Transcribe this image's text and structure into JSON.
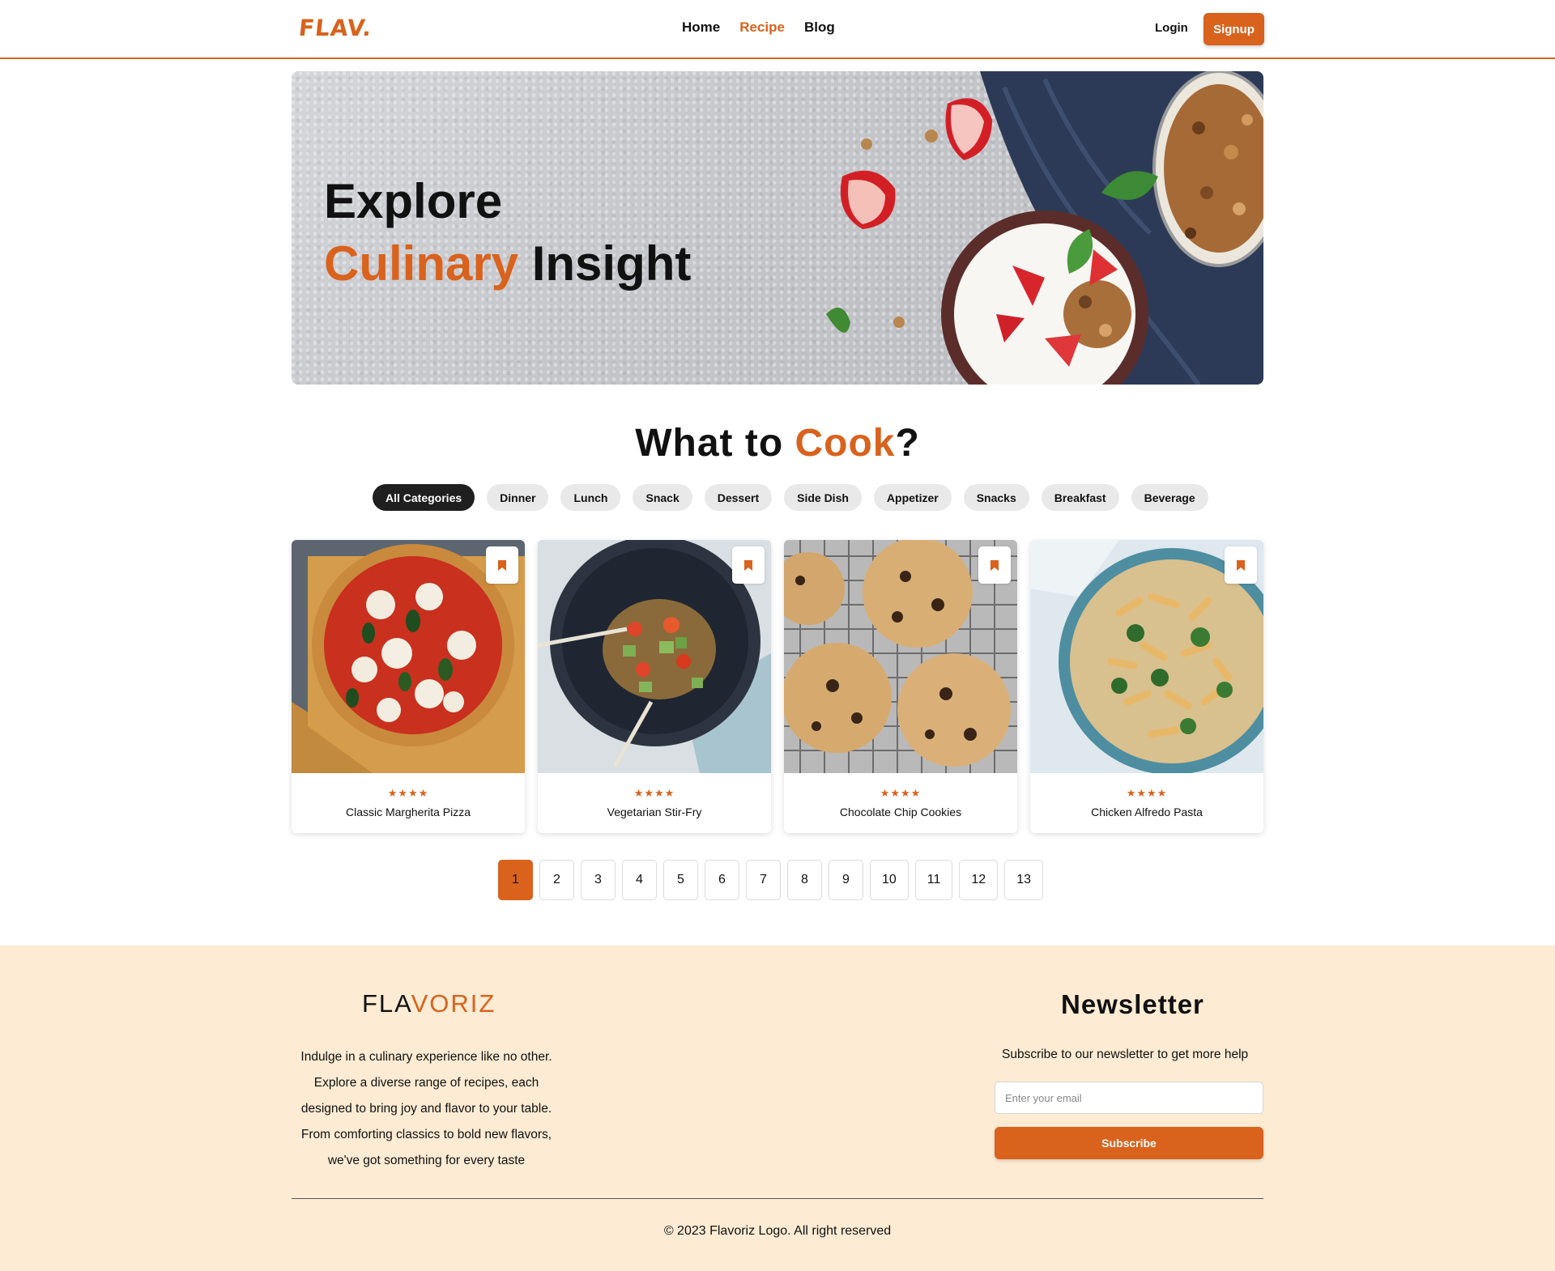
{
  "header": {
    "logo": "FLAV.",
    "nav": [
      {
        "label": "Home",
        "active": false
      },
      {
        "label": "Recipe",
        "active": true
      },
      {
        "label": "Blog",
        "active": false
      }
    ],
    "login": "Login",
    "signup": "Signup"
  },
  "hero": {
    "title_line1": "Explore",
    "title_accent": "Culinary",
    "title_rest": " Insight"
  },
  "section": {
    "title_a": "What to ",
    "title_accent": "Cook",
    "title_b": "?"
  },
  "categories": [
    "All Categories",
    "Dinner",
    "Lunch",
    "Snack",
    "Dessert",
    "Side Dish",
    "Appetizer",
    "Snacks",
    "Breakfast",
    "Beverage"
  ],
  "active_category": "All Categories",
  "recipes": [
    {
      "title": "Classic Margherita Pizza",
      "stars": "★★★★",
      "rating": 4
    },
    {
      "title": "Vegetarian Stir-Fry",
      "stars": "★★★★",
      "rating": 4
    },
    {
      "title": "Chocolate Chip Cookies",
      "stars": "★★★★",
      "rating": 4
    },
    {
      "title": "Chicken Alfredo Pasta",
      "stars": "★★★★",
      "rating": 4
    }
  ],
  "pagination": {
    "pages": [
      "1",
      "2",
      "3",
      "4",
      "5",
      "6",
      "7",
      "8",
      "9",
      "10",
      "11",
      "12",
      "13"
    ],
    "current": "1"
  },
  "footer": {
    "brand_a": "FLA",
    "brand_accent": "VORIZ",
    "description": "Indulge in a culinary experience like no other. Explore a diverse range of recipes, each designed to bring joy and flavor to your table. From comforting classics to bold new flavors, we've got something for every taste",
    "newsletter_title": "Newsletter",
    "newsletter_sub": "Subscribe to our newsletter to get more help",
    "email_placeholder": "Enter your email",
    "subscribe": "Subscribe",
    "copyright": "© 2023 Flavoriz Logo. All right reserved"
  },
  "colors": {
    "accent": "#d9621d",
    "footer_bg": "#fdebd3",
    "active_chip": "#1f1f1f",
    "chip": "#e9e9e9"
  },
  "icons": [
    "bookmark-icon",
    "star-icon"
  ]
}
